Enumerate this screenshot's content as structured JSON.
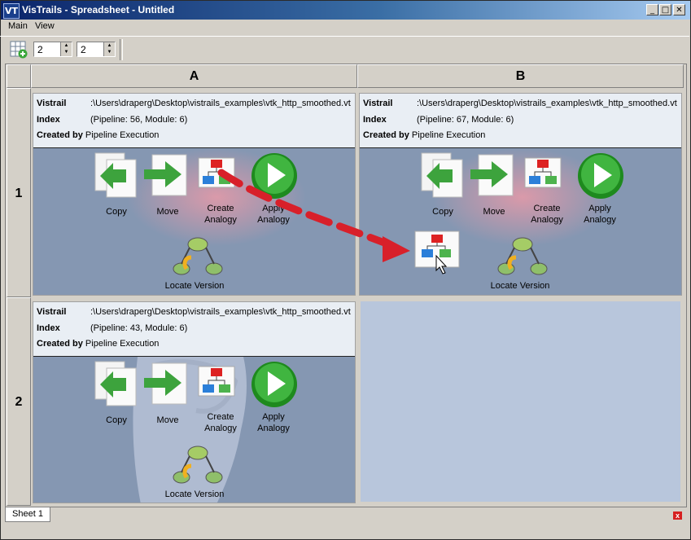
{
  "window": {
    "title": "VisTrails - Spreadsheet - Untitled",
    "icon_text": "VT"
  },
  "title_buttons": {
    "minimize": "_",
    "maximize": "□",
    "close": "✕"
  },
  "menu": {
    "items": [
      "Main",
      "View"
    ]
  },
  "toolbar": {
    "rows_value": "2",
    "cols_value": "2"
  },
  "columns": [
    "A",
    "B"
  ],
  "rows": [
    "1",
    "2"
  ],
  "labels": {
    "vistrail": "Vistrail",
    "index": "Index",
    "created_by": "Created by"
  },
  "cells": {
    "a1": {
      "vistrail": ":\\Users\\draperg\\Desktop\\vistrails_examples\\vtk_http_smoothed.vt",
      "index": "(Pipeline: 56, Module: 6)",
      "created_by": "Pipeline Execution"
    },
    "b1": {
      "vistrail": ":\\Users\\draperg\\Desktop\\vistrails_examples\\vtk_http_smoothed.vt",
      "index": "(Pipeline: 67, Module: 6)",
      "created_by": "Pipeline Execution"
    },
    "a2": {
      "vistrail": ":\\Users\\draperg\\Desktop\\vistrails_examples\\vtk_http_smoothed.vt",
      "index": "(Pipeline: 43, Module: 6)",
      "created_by": "Pipeline Execution"
    }
  },
  "actions": {
    "copy": "Copy",
    "move": "Move",
    "create": "Create\nAnalogy",
    "apply": "Apply\nAnalogy",
    "locate": "Locate Version"
  },
  "sheet_tab": "Sheet 1",
  "close_glyph": "x",
  "icons": {
    "copy": "copy-icon",
    "move": "move-icon",
    "create": "create-analogy-icon",
    "apply": "apply-analogy-icon",
    "locate": "locate-version-icon",
    "toolbar_grid": "add-grid-icon"
  },
  "colors": {
    "title_start": "#0a246a",
    "title_end": "#a6caf0",
    "cell_bg": "#8597b2",
    "empty_cell": "#b8c6dc",
    "arrow": "#d8202a"
  }
}
